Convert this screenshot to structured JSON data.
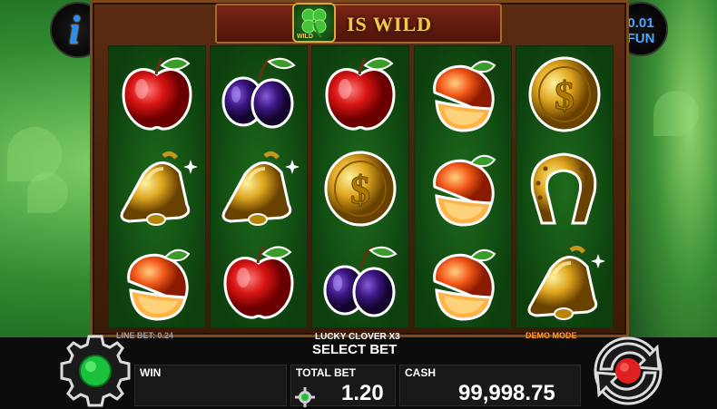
{
  "header": {
    "wild_text": "IS WILD",
    "wild_symbol_label": "WILD"
  },
  "info_button": {
    "icon": "info-icon",
    "glyph": "i"
  },
  "denomination": {
    "value": "0.01",
    "currency": "FUN"
  },
  "reels": [
    [
      "red-apple",
      "golden-bell",
      "peach"
    ],
    [
      "plum",
      "golden-bell",
      "red-apple"
    ],
    [
      "red-apple",
      "dollar-coin",
      "plum"
    ],
    [
      "peach",
      "peach",
      "peach"
    ],
    [
      "dollar-coin",
      "horseshoe",
      "golden-bell"
    ]
  ],
  "bottom_bar": {
    "line_bet_label": "LINE BET: 0.24",
    "game_name": "LUCKY CLOVER X3",
    "select_bet": "SELECT BET",
    "mode": "DEMO MODE",
    "win_label": "WIN",
    "win_value": "",
    "total_bet_label": "TOTAL BET",
    "total_bet_value": "1.20",
    "cash_label": "CASH",
    "cash_value": "99,998.75"
  },
  "colors": {
    "accent": "#f7c64a",
    "spin_red": "#e02020",
    "settings_green": "#19c23a",
    "mode_orange": "#ff9a2e"
  }
}
